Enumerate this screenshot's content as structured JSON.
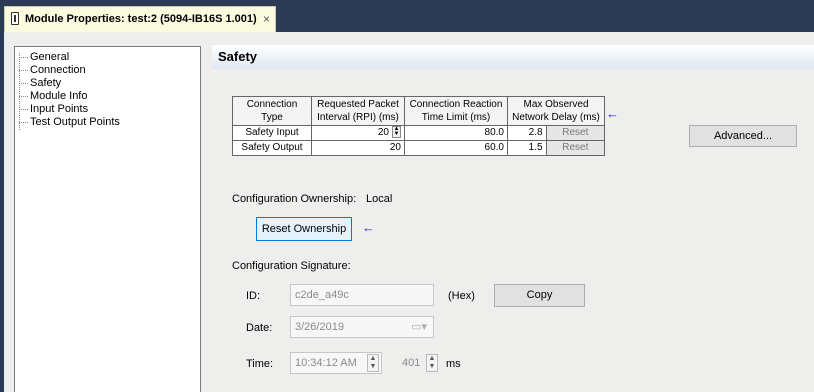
{
  "tab": {
    "title": "Module Properties: test:2 (5094-IB16S 1.001)",
    "close": "×"
  },
  "tree": {
    "items": [
      "General",
      "Connection",
      "Safety",
      "Module Info",
      "Input Points",
      "Test Output Points"
    ]
  },
  "section": {
    "title": "Safety"
  },
  "connection_table": {
    "headers": [
      "Connection Type",
      "Requested Packet Interval (RPI) (ms)",
      "Connection Reaction Time Limit (ms)",
      "Max Observed Network Delay (ms)"
    ],
    "rows": [
      {
        "type": "Safety Input",
        "rpi": "20",
        "crtl": "80.0",
        "delay": "2.8",
        "reset": "Reset"
      },
      {
        "type": "Safety Output",
        "rpi": "20",
        "crtl": "60.0",
        "delay": "1.5",
        "reset": "Reset"
      }
    ]
  },
  "advanced_button": "Advanced...",
  "ownership": {
    "label": "Configuration Ownership:",
    "value": "Local",
    "reset_button": "Reset Ownership"
  },
  "signature": {
    "label": "Configuration Signature:",
    "id_label": "ID:",
    "id_value": "c2de_a49c",
    "id_suffix": "(Hex)",
    "copy_button": "Copy",
    "date_label": "Date:",
    "date_value": "3/26/2019",
    "time_label": "Time:",
    "time_value": "10:34:12 AM",
    "ms_value": "401",
    "ms_label": "ms"
  }
}
